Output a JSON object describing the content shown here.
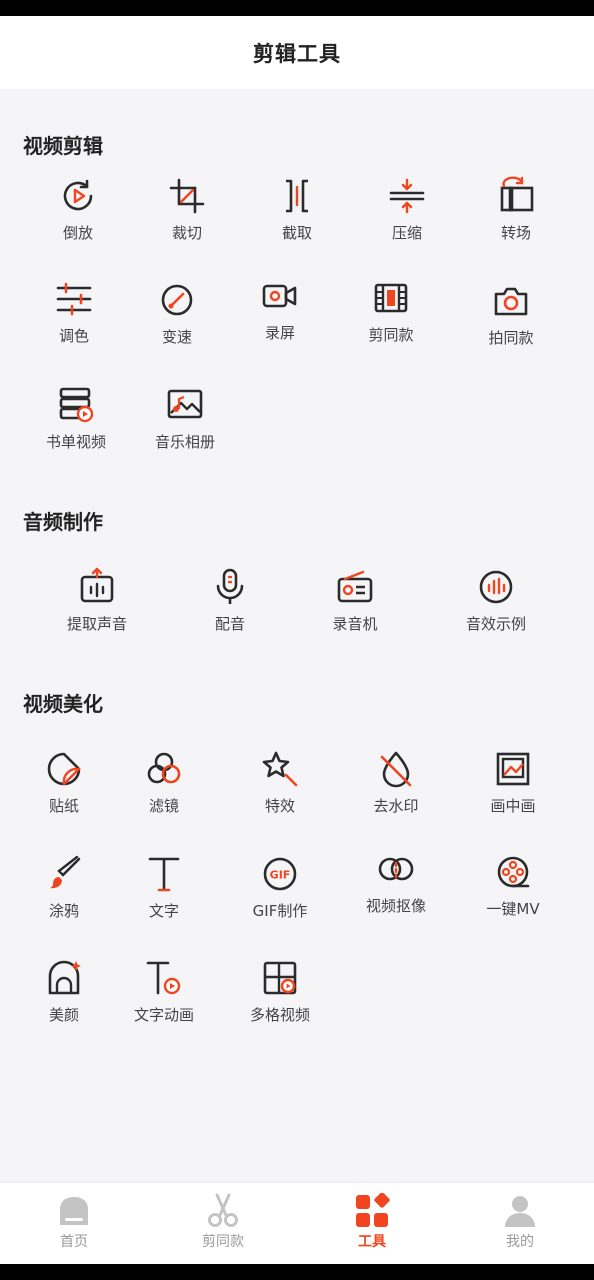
{
  "header": {
    "title": "剪辑工具"
  },
  "sections": {
    "video_edit": {
      "title": "视频剪辑",
      "items": [
        "倒放",
        "裁切",
        "截取",
        "压缩",
        "转场",
        "调色",
        "变速",
        "录屏",
        "剪同款",
        "拍同款",
        "书单视频",
        "音乐相册"
      ]
    },
    "audio": {
      "title": "音频制作",
      "items": [
        "提取声音",
        "配音",
        "录音机",
        "音效示例"
      ]
    },
    "beautify": {
      "title": "视频美化",
      "items": [
        "贴纸",
        "滤镜",
        "特效",
        "去水印",
        "画中画",
        "涂鸦",
        "文字",
        "GIF制作",
        "视频抠像",
        "一键MV",
        "美颜",
        "文字动画",
        "多格视频"
      ]
    }
  },
  "tabbar": {
    "items": [
      "首页",
      "剪同款",
      "工具",
      "我的"
    ],
    "active": "工具"
  },
  "colors": {
    "accent": "#f0451f",
    "icon_dark": "#2b2b2b",
    "background": "#f5f5f7"
  }
}
